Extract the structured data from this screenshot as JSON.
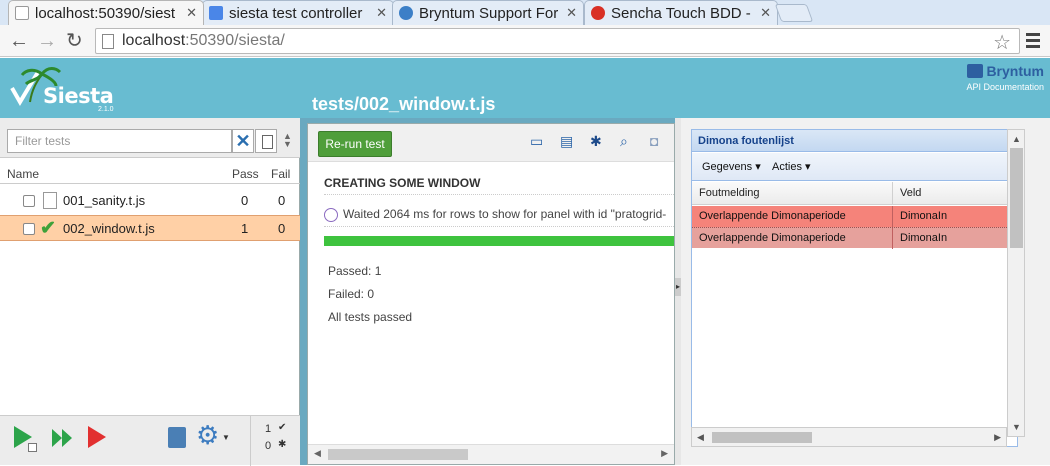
{
  "browser": {
    "tabs": [
      {
        "title": "localhost:50390/siest",
        "favicon_color": "#ffffff"
      },
      {
        "title": "siesta test controller",
        "favicon_color": "#4a86e8"
      },
      {
        "title": "Bryntum Support For",
        "favicon_color": "#3c7fc7"
      },
      {
        "title": "Sencha Touch BDD -",
        "favicon_color": "#d93025"
      }
    ],
    "url_host": "localhost",
    "url_rest": ":50390/siesta/"
  },
  "header": {
    "logo_title": "Siesta",
    "logo_version": "2.1.0",
    "page_title": "tests/002_window.t.js",
    "brand": "Bryntum",
    "api_link": "API Documentation"
  },
  "left": {
    "filter_placeholder": "Filter tests",
    "columns": {
      "name": "Name",
      "pass": "Pass",
      "fail": "Fail"
    },
    "tests": [
      {
        "name": "001_sanity.t.js",
        "pass": "0",
        "fail": "0"
      },
      {
        "name": "002_window.t.js",
        "pass": "1",
        "fail": "0"
      }
    ],
    "stats": {
      "passed": "1",
      "failed": "0"
    }
  },
  "middle": {
    "rerun_label": "Re-run test",
    "section_title": "CREATING SOME WINDOW",
    "message": "Waited 2064 ms for rows to show for panel with id \"pratogrid-",
    "progress": 1.0,
    "passed_line": "Passed: 1",
    "failed_line": "Failed: 0",
    "summary": "All tests passed"
  },
  "frame": {
    "panel_title": "Dimona foutenlijst",
    "toolbar": [
      "Gegevens ▾",
      "Acties ▾"
    ],
    "columns": [
      "Foutmelding",
      "Veld"
    ],
    "rows": [
      {
        "message": "Overlappende Dimonaperiode",
        "field": "DimonaIn",
        "color": "#f5837a"
      },
      {
        "message": "Overlappende Dimonaperiode",
        "field": "DimonaIn",
        "color": "#e6a19c"
      }
    ]
  }
}
